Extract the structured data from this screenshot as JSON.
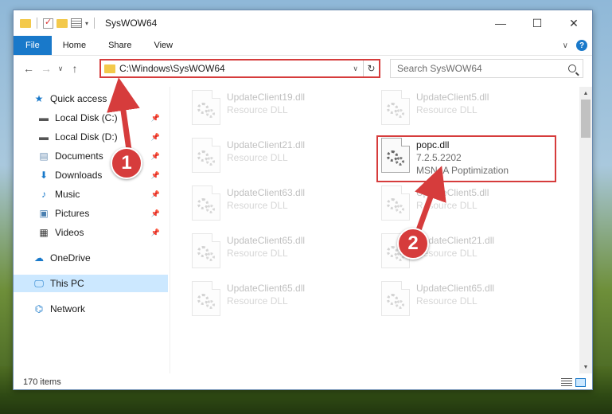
{
  "window": {
    "title": "SysWOW64"
  },
  "ribbon": {
    "tabs": [
      "File",
      "Home",
      "Share",
      "View"
    ]
  },
  "address": {
    "path": "C:\\Windows\\SysWOW64"
  },
  "search": {
    "placeholder": "Search SysWOW64"
  },
  "sidebar": {
    "items": [
      {
        "label": "Quick access",
        "icon": "star-icon"
      },
      {
        "label": "Local Disk (C:)",
        "icon": "drive-icon"
      },
      {
        "label": "Local Disk (D:)",
        "icon": "drive-icon"
      },
      {
        "label": "Documents",
        "icon": "documents-icon"
      },
      {
        "label": "Downloads",
        "icon": "download-icon"
      },
      {
        "label": "Music",
        "icon": "music-icon"
      },
      {
        "label": "Pictures",
        "icon": "pictures-icon"
      },
      {
        "label": "Videos",
        "icon": "video-icon"
      },
      {
        "label": "OneDrive",
        "icon": "cloud-icon"
      },
      {
        "label": "This PC",
        "icon": "monitor-icon"
      },
      {
        "label": "Network",
        "icon": "network-icon"
      }
    ]
  },
  "files": [
    {
      "name": "UpdateClient19.dll",
      "desc": "Resource DLL"
    },
    {
      "name": "UpdateClient5.dll",
      "desc": "Resource DLL"
    },
    {
      "name": "UpdateClient21.dll",
      "desc": "Resource DLL"
    },
    {
      "name": "popc.dll",
      "version": "7.2.5.2202",
      "desc": "MSN IA Poptimization"
    },
    {
      "name": "UpdateClient63.dll",
      "desc": "Resource DLL"
    },
    {
      "name": "UpdateClient5.dll",
      "desc": "Resource DLL"
    },
    {
      "name": "UpdateClient65.dll",
      "desc": "Resource DLL"
    },
    {
      "name": "UpdateClient21.dll",
      "desc": "Resource DLL"
    },
    {
      "name": "UpdateClient65.dll",
      "desc": "Resource DLL"
    },
    {
      "name": "UpdateClient65.dll",
      "desc": "Resource DLL"
    }
  ],
  "status": {
    "item_count": "170 items"
  },
  "annotations": {
    "step1": "1",
    "step2": "2",
    "color": "#d63c3c"
  }
}
